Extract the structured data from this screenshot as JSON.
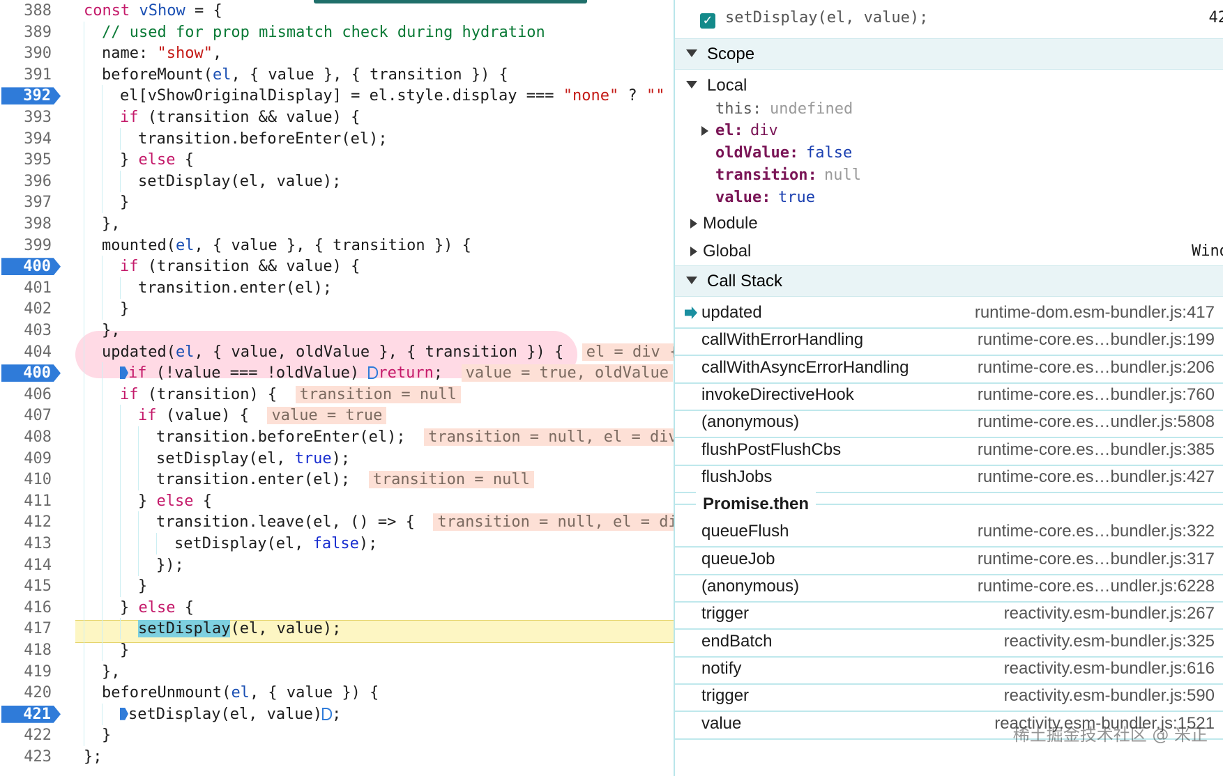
{
  "editor": {
    "lines": [
      {
        "num": "388",
        "indent": 0,
        "bp": false,
        "segments": [
          {
            "t": "const ",
            "c": "kw"
          },
          {
            "t": "vShow",
            "c": "param"
          },
          {
            "t": " = {",
            "c": ""
          }
        ]
      },
      {
        "num": "389",
        "indent": 1,
        "bp": false,
        "segments": [
          {
            "t": "// used for prop mismatch check during hydration",
            "c": "cmt"
          }
        ]
      },
      {
        "num": "390",
        "indent": 1,
        "bp": false,
        "segments": [
          {
            "t": "name: ",
            "c": ""
          },
          {
            "t": "\"show\"",
            "c": "str"
          },
          {
            "t": ",",
            "c": ""
          }
        ]
      },
      {
        "num": "391",
        "indent": 1,
        "bp": false,
        "segments": [
          {
            "t": "beforeMount(",
            "c": ""
          },
          {
            "t": "el",
            "c": "param"
          },
          {
            "t": ", { value }, { transition }) {",
            "c": ""
          }
        ]
      },
      {
        "num": "392",
        "indent": 2,
        "bp": true,
        "segments": [
          {
            "t": "el[vShowOriginalDisplay] = el.style.display === ",
            "c": ""
          },
          {
            "t": "\"none\"",
            "c": "str"
          },
          {
            "t": " ? ",
            "c": ""
          },
          {
            "t": "\"\"",
            "c": "str"
          }
        ]
      },
      {
        "num": "393",
        "indent": 2,
        "bp": false,
        "segments": [
          {
            "t": "if",
            "c": "kw"
          },
          {
            "t": " (transition && value) {",
            "c": ""
          }
        ]
      },
      {
        "num": "394",
        "indent": 3,
        "bp": false,
        "segments": [
          {
            "t": "transition.beforeEnter(el);",
            "c": ""
          }
        ]
      },
      {
        "num": "395",
        "indent": 2,
        "bp": false,
        "segments": [
          {
            "t": "} ",
            "c": ""
          },
          {
            "t": "else",
            "c": "kw"
          },
          {
            "t": " {",
            "c": ""
          }
        ]
      },
      {
        "num": "396",
        "indent": 3,
        "bp": false,
        "segments": [
          {
            "t": "setDisplay(el, value);",
            "c": ""
          }
        ]
      },
      {
        "num": "397",
        "indent": 2,
        "bp": false,
        "segments": [
          {
            "t": "}",
            "c": ""
          }
        ]
      },
      {
        "num": "398",
        "indent": 1,
        "bp": false,
        "segments": [
          {
            "t": "},",
            "c": ""
          }
        ]
      },
      {
        "num": "399",
        "indent": 1,
        "bp": false,
        "segments": [
          {
            "t": "mounted(",
            "c": ""
          },
          {
            "t": "el",
            "c": "param"
          },
          {
            "t": ", { value }, { transition }) {",
            "c": ""
          }
        ]
      },
      {
        "num": "400",
        "indent": 2,
        "bp": true,
        "segments": [
          {
            "t": "if",
            "c": "kw"
          },
          {
            "t": " (transition && value) {",
            "c": ""
          }
        ]
      },
      {
        "num": "401",
        "indent": 3,
        "bp": false,
        "segments": [
          {
            "t": "transition.enter(el);",
            "c": ""
          }
        ]
      },
      {
        "num": "402",
        "indent": 2,
        "bp": false,
        "segments": [
          {
            "t": "}",
            "c": ""
          }
        ]
      },
      {
        "num": "403",
        "indent": 1,
        "bp": false,
        "segments": [
          {
            "t": "},",
            "c": ""
          }
        ]
      },
      {
        "num": "404",
        "indent": 1,
        "bp": false,
        "segments": [
          {
            "t": "updated(",
            "c": ""
          },
          {
            "t": "el",
            "c": "param"
          },
          {
            "t": ", { value, oldValue }, { transition }) {",
            "c": ""
          },
          {
            "t": "  ",
            "c": ""
          },
          {
            "t": "el = div {",
            "c": "inline-val"
          }
        ]
      },
      {
        "num": "400",
        "indent": 2,
        "bp": true,
        "segments": [
          {
            "t": "",
            "c": "exec-marker"
          },
          {
            "t": "if",
            "c": "kw"
          },
          {
            "t": " (!value === !oldValue) ",
            "c": ""
          },
          {
            "t": "",
            "c": "exec-marker hollow"
          },
          {
            "t": "return",
            "c": "kw"
          },
          {
            "t": ";  ",
            "c": ""
          },
          {
            "t": "value = true, oldValue",
            "c": "inline-val"
          }
        ]
      },
      {
        "num": "406",
        "indent": 2,
        "bp": false,
        "segments": [
          {
            "t": "if",
            "c": "kw"
          },
          {
            "t": " (transition) {  ",
            "c": ""
          },
          {
            "t": "transition = null",
            "c": "inline-val"
          }
        ]
      },
      {
        "num": "407",
        "indent": 3,
        "bp": false,
        "segments": [
          {
            "t": "if",
            "c": "kw"
          },
          {
            "t": " (value) {  ",
            "c": ""
          },
          {
            "t": "value = true",
            "c": "inline-val"
          }
        ]
      },
      {
        "num": "408",
        "indent": 4,
        "bp": false,
        "segments": [
          {
            "t": "transition.beforeEnter(el);  ",
            "c": ""
          },
          {
            "t": "transition = null, el = div",
            "c": "inline-val"
          }
        ]
      },
      {
        "num": "409",
        "indent": 4,
        "bp": false,
        "segments": [
          {
            "t": "setDisplay(el, ",
            "c": ""
          },
          {
            "t": "true",
            "c": "lit"
          },
          {
            "t": ");",
            "c": ""
          }
        ]
      },
      {
        "num": "410",
        "indent": 4,
        "bp": false,
        "segments": [
          {
            "t": "transition.enter(el);  ",
            "c": ""
          },
          {
            "t": "transition = null",
            "c": "inline-val"
          }
        ]
      },
      {
        "num": "411",
        "indent": 3,
        "bp": false,
        "segments": [
          {
            "t": "} ",
            "c": ""
          },
          {
            "t": "else",
            "c": "kw"
          },
          {
            "t": " {",
            "c": ""
          }
        ]
      },
      {
        "num": "412",
        "indent": 4,
        "bp": false,
        "segments": [
          {
            "t": "transition.leave(el, () => {  ",
            "c": ""
          },
          {
            "t": "transition = null, el = di",
            "c": "inline-val"
          }
        ]
      },
      {
        "num": "413",
        "indent": 5,
        "bp": false,
        "segments": [
          {
            "t": "setDisplay(el, ",
            "c": ""
          },
          {
            "t": "false",
            "c": "lit"
          },
          {
            "t": ");",
            "c": ""
          }
        ]
      },
      {
        "num": "414",
        "indent": 4,
        "bp": false,
        "segments": [
          {
            "t": "});",
            "c": ""
          }
        ]
      },
      {
        "num": "415",
        "indent": 3,
        "bp": false,
        "segments": [
          {
            "t": "}",
            "c": ""
          }
        ]
      },
      {
        "num": "416",
        "indent": 2,
        "bp": false,
        "segments": [
          {
            "t": "} ",
            "c": ""
          },
          {
            "t": "else",
            "c": "kw"
          },
          {
            "t": " {",
            "c": ""
          }
        ]
      },
      {
        "num": "417",
        "indent": 3,
        "bp": false,
        "segments": [
          {
            "t": "setDisplay",
            "c": "current-token"
          },
          {
            "t": "(el, value);",
            "c": ""
          }
        ]
      },
      {
        "num": "418",
        "indent": 2,
        "bp": false,
        "segments": [
          {
            "t": "}",
            "c": ""
          }
        ]
      },
      {
        "num": "419",
        "indent": 1,
        "bp": false,
        "segments": [
          {
            "t": "},",
            "c": ""
          }
        ]
      },
      {
        "num": "420",
        "indent": 1,
        "bp": false,
        "segments": [
          {
            "t": "beforeUnmount(",
            "c": ""
          },
          {
            "t": "el",
            "c": "param"
          },
          {
            "t": ", { value }) {",
            "c": ""
          }
        ]
      },
      {
        "num": "421",
        "indent": 2,
        "bp": true,
        "segments": [
          {
            "t": "",
            "c": "exec-marker"
          },
          {
            "t": "setDisplay(el, value)",
            "c": ""
          },
          {
            "t": "",
            "c": "exec-marker hollow"
          },
          {
            "t": ";",
            "c": ""
          }
        ]
      },
      {
        "num": "422",
        "indent": 1,
        "bp": false,
        "segments": [
          {
            "t": "}",
            "c": ""
          }
        ]
      },
      {
        "num": "423",
        "indent": 0,
        "bp": false,
        "segments": [
          {
            "t": "};",
            "c": ""
          }
        ]
      }
    ]
  },
  "right_panel": {
    "breakpoint_row": {
      "text": "setDisplay(el, value);",
      "line": "42",
      "checked": true
    },
    "scope": {
      "title": "Scope",
      "local_title": "Local",
      "this_key": "this:",
      "this_val": "undefined",
      "el_key": "el:",
      "el_val": "div",
      "oldValue_key": "oldValue:",
      "oldValue_val": "false",
      "transition_key": "transition:",
      "transition_val": "null",
      "value_key": "value:",
      "value_val": "true",
      "module_label": "Module",
      "global_label": "Global",
      "global_val": "Wind"
    },
    "call_stack": {
      "title": "Call Stack",
      "frames": [
        {
          "name": "updated",
          "loc": "runtime-dom.esm-bundler.js:417",
          "current": true
        },
        {
          "name": "callWithErrorHandling",
          "loc": "runtime-core.es…bundler.js:199",
          "current": false
        },
        {
          "name": "callWithAsyncErrorHandling",
          "loc": "runtime-core.es…bundler.js:206",
          "current": false
        },
        {
          "name": "invokeDirectiveHook",
          "loc": "runtime-core.es…bundler.js:760",
          "current": false
        },
        {
          "name": "(anonymous)",
          "loc": "runtime-core.es…undler.js:5808",
          "current": false
        },
        {
          "name": "flushPostFlushCbs",
          "loc": "runtime-core.es…bundler.js:385",
          "current": false
        },
        {
          "name": "flushJobs",
          "loc": "runtime-core.es…bundler.js:427",
          "current": false
        }
      ],
      "async_label": "Promise.then",
      "frames_after": [
        {
          "name": "queueFlush",
          "loc": "runtime-core.es…bundler.js:322"
        },
        {
          "name": "queueJob",
          "loc": "runtime-core.es…bundler.js:317"
        },
        {
          "name": "(anonymous)",
          "loc": "runtime-core.es…undler.js:6228"
        },
        {
          "name": "trigger",
          "loc": "reactivity.esm-bundler.js:267"
        },
        {
          "name": "endBatch",
          "loc": "reactivity.esm-bundler.js:325"
        },
        {
          "name": "notify",
          "loc": "reactivity.esm-bundler.js:616"
        },
        {
          "name": "trigger",
          "loc": "reactivity.esm-bundler.js:590"
        },
        {
          "name": "value",
          "loc": "reactivity.esm-bundler.js:1521"
        }
      ]
    }
  },
  "watermark": "稀土掘金技术社区 @ 米正",
  "colors": {
    "accent": "#2f7bd9",
    "current_line": "#fdf6c3",
    "inline_value_bg": "#fde0d6",
    "keyword": "#c41a6a",
    "string": "#c41a16",
    "comment": "#0a7a36"
  }
}
